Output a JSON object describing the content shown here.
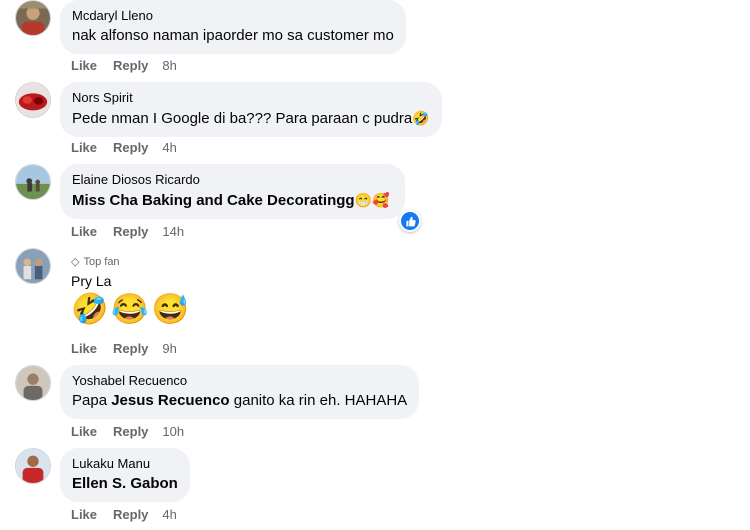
{
  "actions": {
    "like": "Like",
    "reply": "Reply"
  },
  "comments": [
    {
      "author": "Mcdaryl Lleno",
      "text": "nak alfonso naman ipaorder mo sa customer mo",
      "time": "8h"
    },
    {
      "author": "Nors Spirit",
      "text": "Pede nman I Google di ba??? Para paraan c pudra",
      "emoji": "🤣",
      "time": "4h"
    },
    {
      "author": "Elaine Diosos Ricardo",
      "text": "Miss Cha Baking and Cake Decoratingg",
      "emoji": "😁🥰",
      "time": "14h"
    },
    {
      "badge": "Top fan",
      "author": "Pry La",
      "emojis": "🤣😂😅",
      "time": "9h"
    },
    {
      "author": "Yoshabel Recuenco",
      "text_before": "Papa ",
      "mention": "Jesus Recuenco",
      "text_after": " ganito ka rin eh. HAHAHA",
      "time": "10h"
    },
    {
      "author": "Lukaku Manu",
      "text": "Ellen S. Gabon",
      "time": "4h"
    }
  ],
  "colors": {
    "bubble": "#f0f2f5",
    "secondary_text": "#65676b",
    "like_blue": "#1877f2"
  }
}
